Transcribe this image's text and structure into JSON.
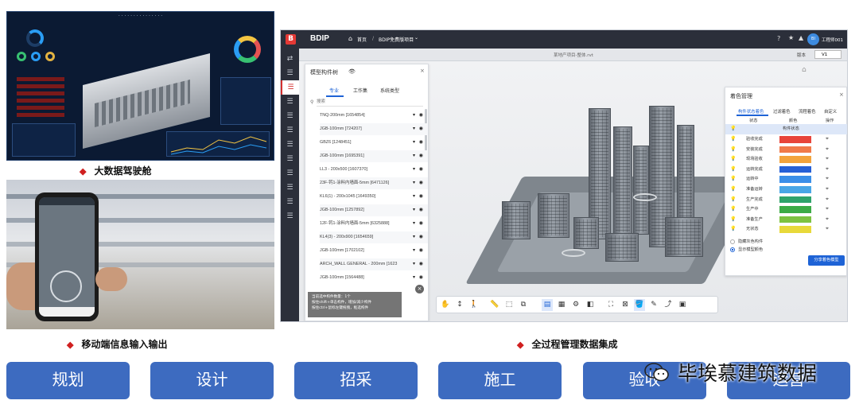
{
  "dashboard": {
    "caption": "大数据驾驶舱"
  },
  "mobile": {
    "caption": "移动端信息输入输出"
  },
  "bdip": {
    "caption": "全过程管理数据集成",
    "brand": "BDIP",
    "breadcrumb_home": "首页",
    "breadcrumb_project": "BDIP免费版项目",
    "user_avatar": "BI",
    "user_name": "工程师001",
    "model_file": "某地产项目-整体.rvt",
    "version_label": "版本",
    "version_value": "V1",
    "tree": {
      "title": "模型构件树",
      "tabs": [
        "专业",
        "工作集",
        "系统类型"
      ],
      "search_placeholder": "搜索",
      "items": [
        "TNQ-200mm [1654854]",
        "JGB-100mm [724207]",
        "GBZ6 [1248451]",
        "JGB-100mm [1695391]",
        "LL3 - 200x500 [1607370]",
        "23F-钙1-涂料内墙面-5mm [6471126]",
        "KL6(1) - 200x1045 [1649350]",
        "JGB-100mm [1257892]",
        "12F-钙1-涂料内墙面-5mm [6325888]",
        "KL4(3) - 200x900 [1654659]",
        "JGB-100mm [1702102]",
        "ARCH_WALL GENERAL - 200mm [1623",
        "JGB-100mm [1564488]"
      ],
      "hint_lines": [
        "当前选中构件数量：1个",
        "按住shift+单击构件，增加/减少构件",
        "按住ctrl+鼠标左键拖拽，框选构件"
      ]
    },
    "colors": {
      "title": "着色管理",
      "tabs": [
        "构件状态着色",
        "过滤着色",
        "流程着色",
        "自定义"
      ],
      "headers": [
        "状态",
        "颜色",
        "操作"
      ],
      "group": "构件状态",
      "rows": [
        {
          "label": "验收完成",
          "color": "#e8443a"
        },
        {
          "label": "安装完成",
          "color": "#f07a4a"
        },
        {
          "label": "现场验收",
          "color": "#f3a33c"
        },
        {
          "label": "运转完成",
          "color": "#2660d6"
        },
        {
          "label": "运转中",
          "color": "#3b8fe8"
        },
        {
          "label": "准备运转",
          "color": "#49a6e6"
        },
        {
          "label": "生产完成",
          "color": "#2fa36a"
        },
        {
          "label": "生产中",
          "color": "#3cab46"
        },
        {
          "label": "准备生产",
          "color": "#7dc241"
        },
        {
          "label": "无状态",
          "color": "#e8d93a"
        }
      ],
      "option_hide": "隐藏灰色构件",
      "option_show": "显示模型颜色",
      "share_button": "分享着色模型"
    }
  },
  "process_buttons": [
    "规划",
    "设计",
    "招采",
    "施工",
    "验收",
    "运营"
  ],
  "watermark": "毕埃慕建筑数据"
}
